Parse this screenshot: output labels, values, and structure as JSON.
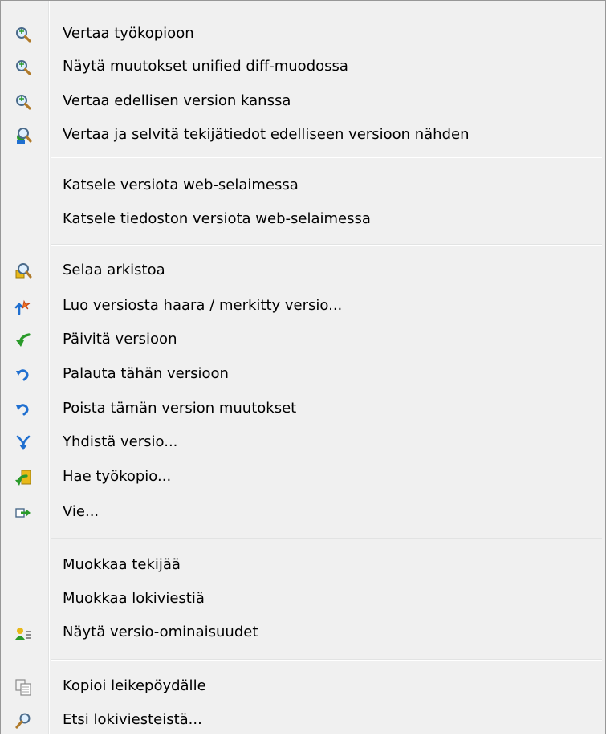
{
  "menu": {
    "group1": [
      {
        "label": "Vertaa työkopioon",
        "icon": "magnifier-icon"
      },
      {
        "label": "Näytä muutokset unified diff-muodossa",
        "icon": "magnifier-icon"
      },
      {
        "label": "Vertaa edellisen version kanssa",
        "icon": "magnifier-icon"
      },
      {
        "label": "Vertaa ja selvitä tekijätiedot edelliseen versioon nähden",
        "icon": "blame-compare-icon"
      }
    ],
    "group2": [
      {
        "label": "Katsele versiota web-selaimessa"
      },
      {
        "label": "Katsele tiedoston versiota web-selaimessa"
      }
    ],
    "group3": [
      {
        "label": "Selaa arkistoa",
        "icon": "repo-browser-icon"
      },
      {
        "label": "Luo versiosta haara / merkitty versio...",
        "icon": "branch-tag-icon"
      },
      {
        "label": "Päivitä versioon",
        "icon": "update-icon"
      },
      {
        "label": "Palauta tähän versioon",
        "icon": "revert-icon"
      },
      {
        "label": "Poista tämän version muutokset",
        "icon": "revert-icon"
      },
      {
        "label": "Yhdistä versio...",
        "icon": "merge-icon"
      },
      {
        "label": "Hae työkopio...",
        "icon": "checkout-icon"
      },
      {
        "label": "Vie...",
        "icon": "export-icon"
      }
    ],
    "group4": [
      {
        "label": "Muokkaa tekijää"
      },
      {
        "label": "Muokkaa lokiviestiä"
      },
      {
        "label": "Näytä versio-ominaisuudet",
        "icon": "properties-icon"
      }
    ],
    "group5": [
      {
        "label": "Kopioi leikepöydälle",
        "icon": "copy-icon"
      },
      {
        "label": "Etsi lokiviesteistä...",
        "icon": "search-icon"
      }
    ]
  },
  "colors": {
    "menu_background": "#f0f0f0",
    "border": "#979797",
    "separator": "#e2e3e3",
    "icon_blue": "#1f6fd0",
    "icon_green": "#2a9a2a",
    "icon_yellow": "#e8b818"
  }
}
